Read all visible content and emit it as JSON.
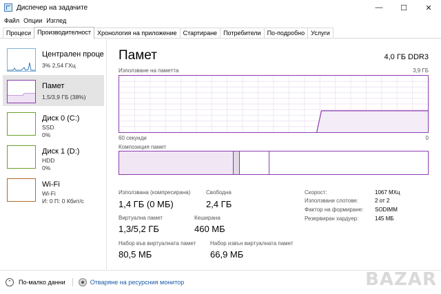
{
  "window": {
    "title": "Диспечер на задачите",
    "controls": {
      "minimize": "—",
      "maximize": "☐",
      "close": "✕"
    }
  },
  "menu": [
    "Файл",
    "Опции",
    "Изглед"
  ],
  "tabs": [
    {
      "label": "Процеси"
    },
    {
      "label": "Производителност",
      "active": true
    },
    {
      "label": "Хронология на приложение"
    },
    {
      "label": "Стартиране"
    },
    {
      "label": "Потребители"
    },
    {
      "label": "По-подробно"
    },
    {
      "label": "Услуги"
    }
  ],
  "sidebar": {
    "items": [
      {
        "title": "Централен проце",
        "sub1": "3% 2,54 ГХц",
        "sub2": ""
      },
      {
        "title": "Памет",
        "sub1": "1,5/3,9 ГБ (38%)",
        "sub2": "",
        "selected": true
      },
      {
        "title": "Диск 0 (C:)",
        "sub1": "SSD",
        "sub2": "0%"
      },
      {
        "title": "Диск 1 (D:)",
        "sub1": "HDD",
        "sub2": "0%"
      },
      {
        "title": "Wi-Fi",
        "sub1": "Wi-Fi",
        "sub2": "И: 0 П: 0 Кбит/с"
      }
    ]
  },
  "main": {
    "title": "Памет",
    "spec": "4,0 ГБ DDR3",
    "usage_label": "Използване на паметта",
    "usage_max": "3,9 ГБ",
    "time_left": "60 секунди",
    "time_right": "0",
    "composition_label": "Композиция памет",
    "usage_fraction": 0.38
  },
  "stats": {
    "in_use_label": "Използвана (компресирана)",
    "in_use_value": "1,4 ГБ (0 МБ)",
    "available_label": "Свободна",
    "available_value": "2,4 ГБ",
    "committed_label": "Виртуална памет",
    "committed_value": "1,3/5,2 ГБ",
    "cached_label": "Кеширана",
    "cached_value": "460 МБ",
    "paged_label": "Набор във виртуалната памет",
    "paged_value": "80,5 МБ",
    "nonpaged_label": "Набор извън виртуалната памет",
    "nonpaged_value": "66,9 МБ"
  },
  "details": [
    {
      "label": "Скорост:",
      "value": "1067 МХц"
    },
    {
      "label": "Използвани слотове:",
      "value": "2 от 2"
    },
    {
      "label": "Фактор на формиране:",
      "value": "SODIMM"
    },
    {
      "label": "Резервиран хардуер:",
      "value": "145 МБ"
    }
  ],
  "footer": {
    "fewer_details": "По-малко данни",
    "resource_monitor": "Отваряне на ресурсния монитор"
  },
  "watermark": "BAZAR",
  "colors": {
    "memory": "#8b3ab0",
    "cpu": "#7fb0d6",
    "disk": "#6aa02a",
    "wifi": "#b06a2a"
  }
}
